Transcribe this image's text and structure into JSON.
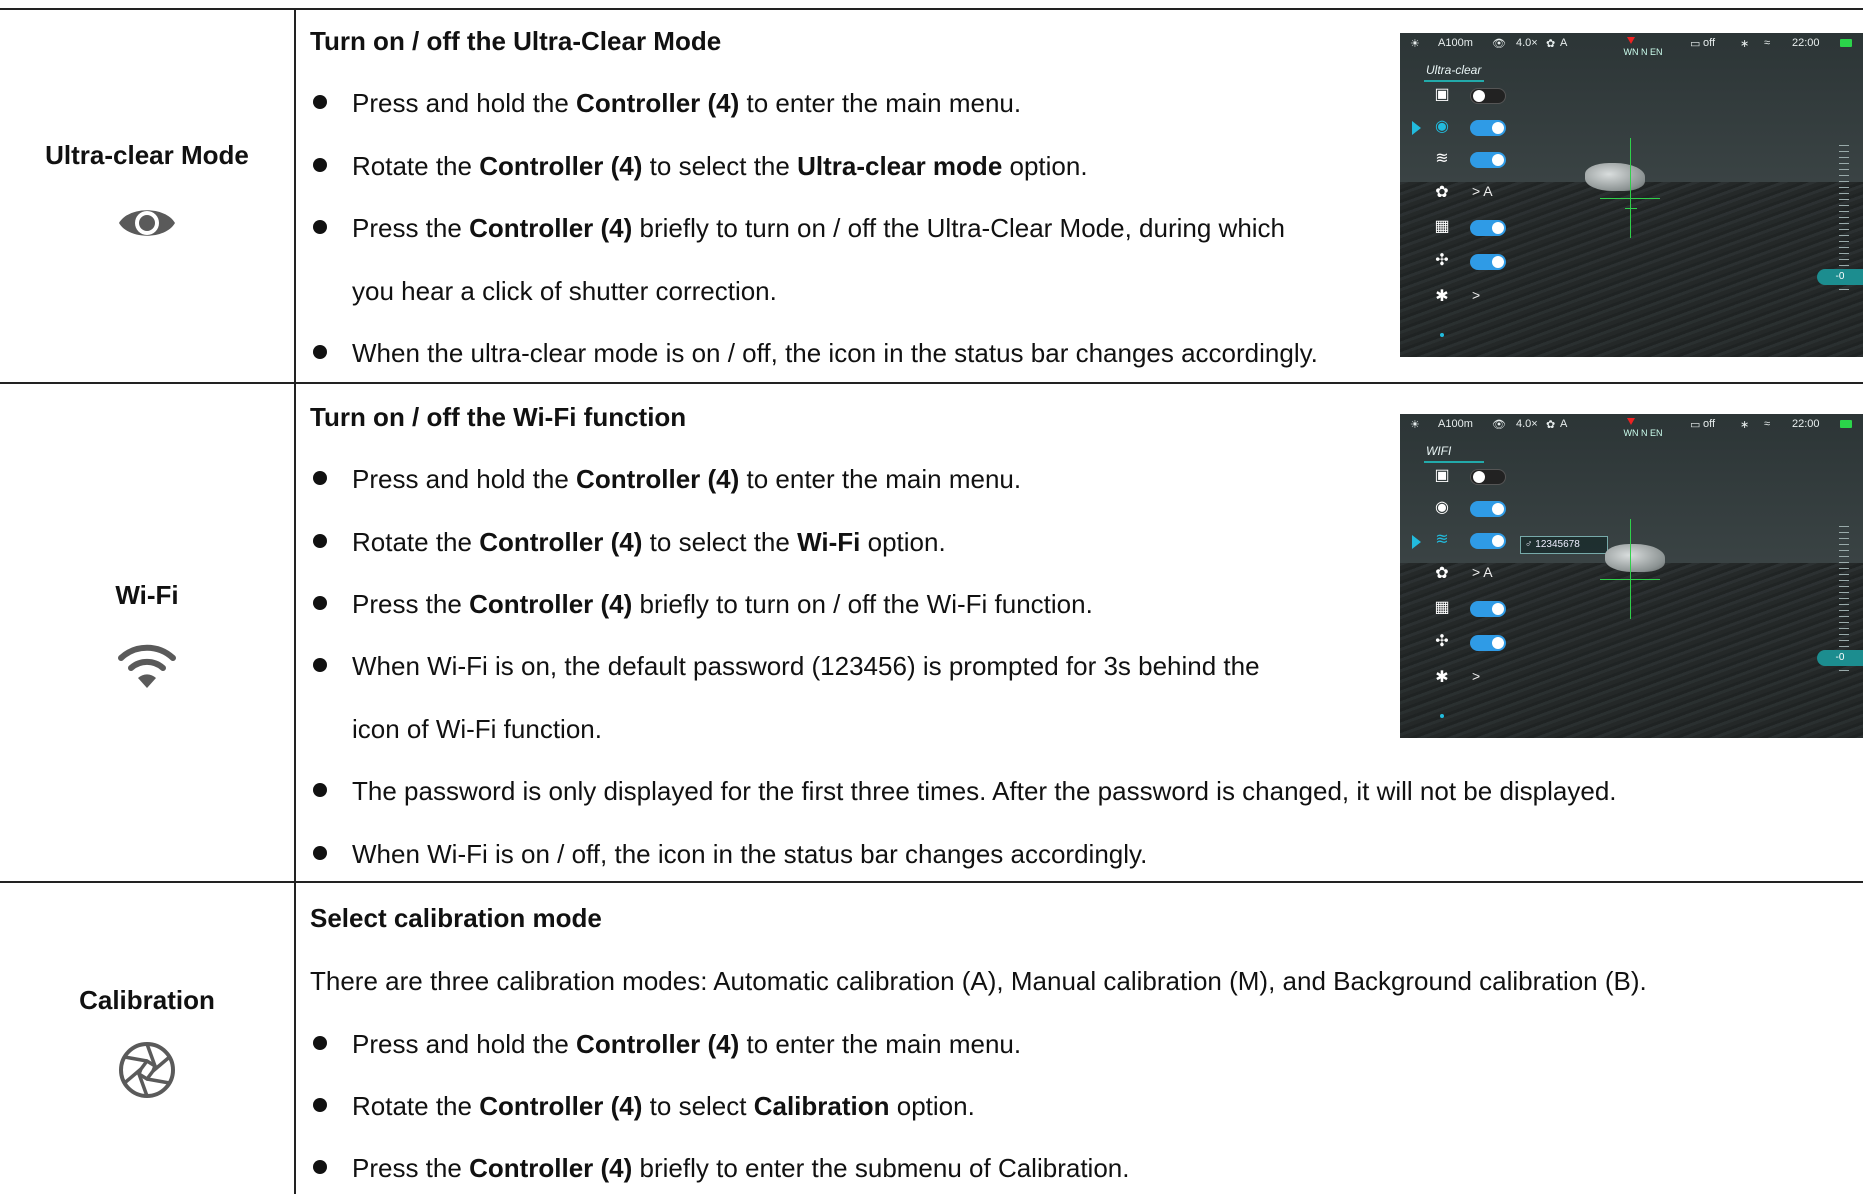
{
  "rows": [
    {
      "label": "Ultra-clear Mode",
      "icon": "eye-icon",
      "heading": "Turn on / off the Ultra-Clear Mode",
      "bullets": [
        {
          "pre": "Press and hold the ",
          "b1": "Controller (4)",
          "mid": " to enter the main menu.",
          "b2": "",
          "post": ""
        },
        {
          "pre": "Rotate the ",
          "b1": "Controller (4)",
          "mid": " to select the ",
          "b2": "Ultra-clear mode",
          "post": " option."
        },
        {
          "pre": "Press the ",
          "b1": "Controller (4)",
          "mid": " briefly to turn on / off the Ultra-Clear Mode, during which",
          "b2": "",
          "post": "",
          "cont": "you hear a click of shutter correction."
        },
        {
          "pre": "When the ultra-clear mode is on / off, the icon in the status bar changes accordingly.",
          "b1": "",
          "mid": "",
          "b2": "",
          "post": ""
        }
      ],
      "screen": {
        "status": {
          "range": "A100m",
          "zoom": "4.0×",
          "cal": "A",
          "pip": "off",
          "time": "22:00",
          "compass": "WN  N  EN"
        },
        "menu_title": "Ultra-clear",
        "menu_sub_calibration": "> A",
        "menu_sub_bt": ">",
        "scale_tag": "-0"
      }
    },
    {
      "label": "Wi-Fi",
      "icon": "wifi-icon",
      "heading": "Turn on / off the Wi-Fi function",
      "bullets": [
        {
          "pre": "Press and hold the ",
          "b1": "Controller (4)",
          "mid": " to enter the main menu.",
          "b2": "",
          "post": ""
        },
        {
          "pre": "Rotate the ",
          "b1": "Controller (4)",
          "mid": " to select the ",
          "b2": "Wi-Fi",
          "post": " option."
        },
        {
          "pre": "Press the ",
          "b1": "Controller (4)",
          "mid": " briefly to turn on / off the Wi-Fi function.",
          "b2": "",
          "post": ""
        },
        {
          "pre": "When Wi-Fi is on, the default password (123456) is prompted for 3s behind the",
          "b1": "",
          "mid": "",
          "b2": "",
          "post": "",
          "cont": "icon of Wi-Fi function."
        },
        {
          "pre": "The password is only displayed for the first three times. After the password is changed, it will not be displayed.",
          "b1": "",
          "mid": "",
          "b2": "",
          "post": ""
        },
        {
          "pre": "When Wi-Fi is on / off, the icon in the status bar changes accordingly.",
          "b1": "",
          "mid": "",
          "b2": "",
          "post": ""
        }
      ],
      "screen": {
        "status": {
          "range": "A100m",
          "zoom": "4.0×",
          "cal": "A",
          "pip": "off",
          "time": "22:00",
          "compass": "WN  N  EN"
        },
        "menu_title": "WIFI",
        "password": "12345678",
        "menu_sub_calibration": "> A",
        "menu_sub_bt": ">",
        "scale_tag": "-0"
      }
    },
    {
      "label": "Calibration",
      "icon": "aperture-icon",
      "heading": "Select calibration mode",
      "intro": "There are three calibration modes: Automatic calibration (A), Manual calibration (M), and Background calibration (B).",
      "bullets": [
        {
          "pre": "Press and hold the ",
          "b1": "Controller (4)",
          "mid": " to enter the main menu.",
          "b2": "",
          "post": ""
        },
        {
          "pre": "Rotate the ",
          "b1": "Controller (4)",
          "mid": " to select ",
          "b2": "Calibration",
          "post": " option."
        },
        {
          "pre": "Press the ",
          "b1": "Controller (4)",
          "mid": " briefly to enter the submenu of Calibration.",
          "b2": "",
          "post": ""
        }
      ]
    }
  ]
}
